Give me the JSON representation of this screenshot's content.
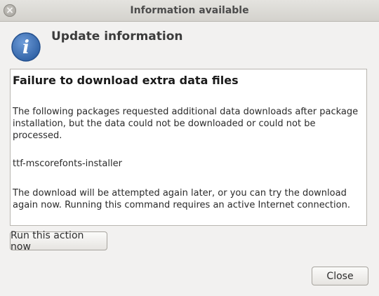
{
  "window": {
    "title": "Information available",
    "close_glyph": "×"
  },
  "header": {
    "icon": "info-icon",
    "icon_glyph": "i",
    "title": "Update information"
  },
  "content": {
    "title": "Failure to download extra data files",
    "paragraph1": "The following packages requested additional data downloads after package installation, but the data could not be downloaded or could not be processed.",
    "package": "ttf-mscorefonts-installer",
    "paragraph2": "The download will be attempted again later, or you can try the download again now.  Running this command requires an active Internet connection."
  },
  "buttons": {
    "run_now": "Run this action now",
    "close": "Close"
  },
  "colors": {
    "icon_blue": "#3a6fb5",
    "window_bg": "#f2f1f0"
  }
}
